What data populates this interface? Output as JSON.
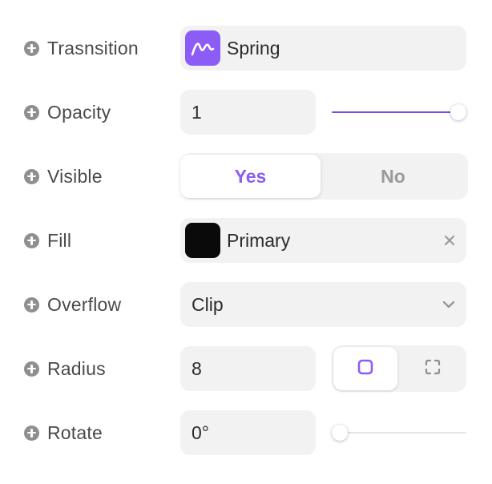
{
  "colors": {
    "accent": "#8b5cf6",
    "accent_dark": "#7a4fe0",
    "field_bg": "#f2f2f2",
    "label": "#4a4a4a",
    "fill_swatch": "#0a0a0a"
  },
  "rows": {
    "transition": {
      "label": "Trasnsition",
      "value": "Spring",
      "icon": "spring-curve-icon"
    },
    "opacity": {
      "label": "Opacity",
      "value": "1",
      "slider_fraction": 1.0
    },
    "visible": {
      "label": "Visible",
      "options": [
        "Yes",
        "No"
      ],
      "selected": "Yes"
    },
    "fill": {
      "label": "Fill",
      "value": "Primary",
      "icon": "close-icon"
    },
    "overflow": {
      "label": "Overflow",
      "value": "Clip",
      "icon": "chevron-down-icon"
    },
    "radius": {
      "label": "Radius",
      "value": "8",
      "modes": [
        "uniform-radius-icon",
        "individual-corners-icon"
      ],
      "selected_mode": "uniform-radius-icon"
    },
    "rotate": {
      "label": "Rotate",
      "value": "0°",
      "slider_fraction": 0.0
    }
  }
}
